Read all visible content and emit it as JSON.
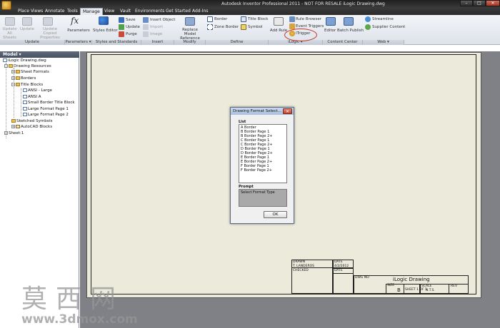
{
  "window": {
    "title": "Autodesk Inventor Professional 2011 - NOT FOR RESALE   iLogic Drawing.dwg",
    "minimize": "–",
    "maximize": "□",
    "close": "✕"
  },
  "tabs": [
    "Place Views",
    "Annotate",
    "Tools",
    "Manage",
    "View",
    "Vault",
    "Environments",
    "Get Started",
    "Add-Ins"
  ],
  "ribbon": {
    "update": {
      "label": "Update",
      "buttons": [
        "Update All Sheets",
        "Update",
        "Update Copied Properties"
      ]
    },
    "parameters": {
      "label": "Parameters ▾",
      "buttons": [
        "Parameters"
      ]
    },
    "styles": {
      "label": "Styles and Standards",
      "buttons": [
        "Styles Editor",
        "Save",
        "Update",
        "Purge"
      ]
    },
    "insert": {
      "label": "Insert",
      "buttons": [
        "Insert Object",
        "Import",
        "Image"
      ]
    },
    "modify": {
      "label": "Modify",
      "buttons": [
        "Replace Model Reference"
      ]
    },
    "define": {
      "label": "Define",
      "buttons": [
        "Border",
        "Zone Border",
        "Title Block",
        "Symbol"
      ]
    },
    "ilogic": {
      "label": "iLogic ▾",
      "buttons": [
        "Add Rule",
        "Rule Browser",
        "Event Triggers",
        "iTrigger"
      ]
    },
    "content_center": {
      "label": "Content Center",
      "buttons": [
        "Editor",
        "Batch Publish"
      ]
    },
    "web": {
      "label": "Web ▾",
      "buttons": [
        "Streamline",
        "Supplier Content"
      ]
    }
  },
  "browser": {
    "header": "Model ▾",
    "tree": [
      "iLogic Drawing.dwg",
      "Drawing Resources",
      "Sheet Formats",
      "Borders",
      "Title Blocks",
      "ANSI - Large",
      "ANSI A",
      "Small Border Title Block",
      "Large Format Page 1",
      "Large Format Page 2",
      "Sketched Symbols",
      "AutoCAD Blocks",
      "Sheet:1"
    ]
  },
  "dialog": {
    "title": "Drawing Format Select...",
    "close": "✕",
    "list_label": "List",
    "items": [
      "A Border",
      "B Border Page 1",
      "B Border Page 2+",
      "C Border Page 1",
      "C Border Page 2+",
      "D Border Page 1",
      "D Border Page 2+",
      "E Border Page 1",
      "E Border Page 2+",
      "F Border Page 1",
      "F Border Page 2+"
    ],
    "prompt_label": "Prompt",
    "prompt_text": "Select Format Type",
    "ok_label": "OK"
  },
  "title_block": {
    "drawn": "DRAWN",
    "drawn_by": "T. LANDEROS",
    "checked": "CHECKED",
    "date": "DATE",
    "date_value": "4/2/2012",
    "date2": "DATE",
    "dwg_no": "DWG NO",
    "title": "iLogic Drawing",
    "size_label": "SIZE",
    "size": "B",
    "sheet": "SHEET 1   OF 1",
    "scale_label": "SCALE",
    "scale": "N.T.S.",
    "rev": "REV"
  },
  "watermark": {
    "cn": "莫西网",
    "url": "www.3dmox.com"
  },
  "colors": {
    "sheet_bg": "#eceadb",
    "canvas_bg": "#7f8186",
    "highlight": "#c0392b"
  }
}
